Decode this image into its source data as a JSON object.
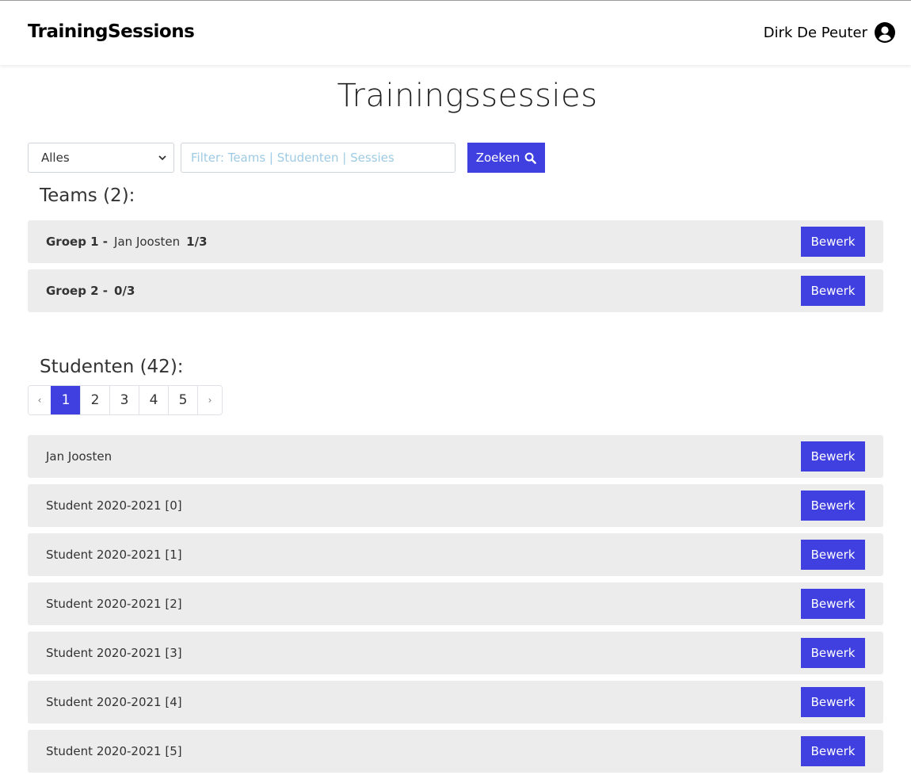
{
  "header": {
    "brand": "TrainingSessions",
    "user_name": "Dirk De Peuter"
  },
  "page_title": "Trainingssessies",
  "filter": {
    "select_value": "Alles",
    "search_placeholder": "Filter: Teams | Studenten | Sessies",
    "search_button": "Zoeken"
  },
  "teams": {
    "title": "Teams (2):",
    "items": [
      {
        "name": "Groep 1 -",
        "member": "Jan Joosten",
        "count": "1/3",
        "button": "Bewerk"
      },
      {
        "name": "Groep 2 -",
        "member": "",
        "count": "0/3",
        "button": "Bewerk"
      }
    ]
  },
  "students": {
    "title": "Studenten (42):",
    "pagination": {
      "prev": "‹",
      "pages": [
        "1",
        "2",
        "3",
        "4",
        "5"
      ],
      "active": "1",
      "next": "›"
    },
    "items": [
      {
        "name": "Jan Joosten",
        "button": "Bewerk"
      },
      {
        "name": "Student 2020-2021 [0]",
        "button": "Bewerk"
      },
      {
        "name": "Student 2020-2021 [1]",
        "button": "Bewerk"
      },
      {
        "name": "Student 2020-2021 [2]",
        "button": "Bewerk"
      },
      {
        "name": "Student 2020-2021 [3]",
        "button": "Bewerk"
      },
      {
        "name": "Student 2020-2021 [4]",
        "button": "Bewerk"
      },
      {
        "name": "Student 2020-2021 [5]",
        "button": "Bewerk"
      }
    ]
  },
  "colors": {
    "accent": "#4040e0",
    "row_background": "#ececec",
    "placeholder": "#9ecbe3"
  }
}
